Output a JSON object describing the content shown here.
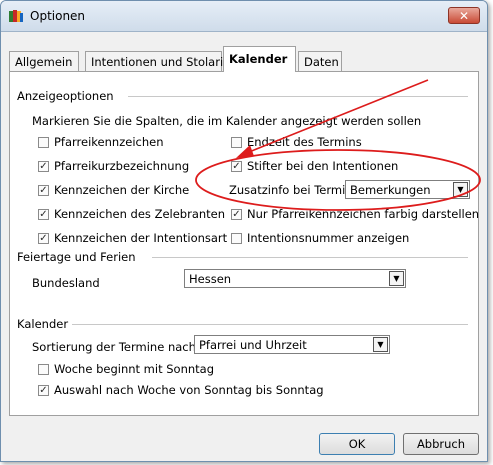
{
  "window": {
    "title": "Optionen",
    "close_glyph": "✕"
  },
  "tabs": [
    {
      "label": "Allgemein"
    },
    {
      "label": "Intentionen und Stolarien"
    },
    {
      "label": "Kalender"
    },
    {
      "label": "Daten"
    }
  ],
  "active_tab": "Kalender",
  "display_options": {
    "group_label": "Anzeigeoptionen",
    "instruction": "Markieren Sie die Spalten, die im Kalender angezeigt werden sollen",
    "checkboxes": [
      {
        "label": "Pfarreikennzeichen",
        "checked": false
      },
      {
        "label": "Endzeit des Termins",
        "checked": false
      },
      {
        "label": "Pfarreikurzbezeichnung",
        "checked": true
      },
      {
        "label": "Stifter bei den Intentionen",
        "checked": true
      },
      {
        "label": "Kennzeichen der Kirche",
        "checked": true
      },
      {
        "label": "Kennzeichen des Zelebranten",
        "checked": true
      },
      {
        "label": "Nur Pfarreikennzeichen farbig darstellen",
        "checked": true
      },
      {
        "label": "Kennzeichen der Intentionsart",
        "checked": true
      },
      {
        "label": "Intentionsnummer anzeigen",
        "checked": false
      }
    ],
    "extra_info_label": "Zusatzinfo bei Termin",
    "extra_info_value": "Bemerkungen"
  },
  "holidays": {
    "group_label": "Feiertage und Ferien",
    "state_label": "Bundesland",
    "state_value": "Hessen"
  },
  "calendar": {
    "group_label": "Kalender",
    "sort_label": "Sortierung der Termine nach",
    "sort_value": "Pfarrei und Uhrzeit",
    "checkboxes": [
      {
        "label": "Woche beginnt mit Sonntag",
        "checked": false
      },
      {
        "label": "Auswahl nach Woche von Sonntag bis Sonntag",
        "checked": true
      }
    ]
  },
  "buttons": {
    "ok": "OK",
    "cancel": "Abbruch"
  },
  "colors": {
    "annotation": "#dd1c1c",
    "window_border": "#6f8fae",
    "close_button": "#c94a35"
  },
  "icons": {
    "check": "✓",
    "dropdown": "▼"
  }
}
